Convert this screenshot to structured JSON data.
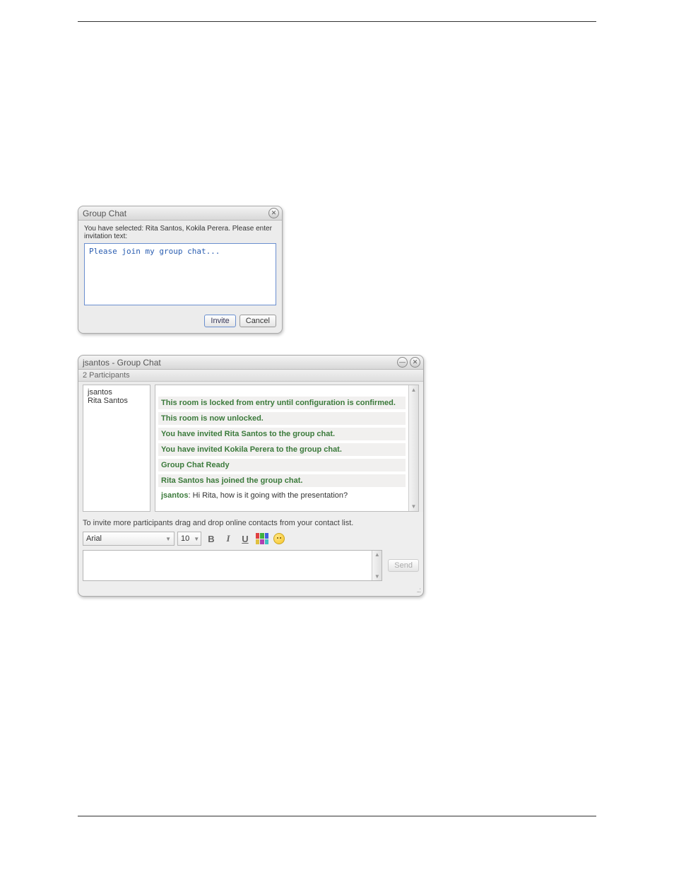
{
  "invite_dialog": {
    "title": "Group Chat",
    "selected_text": "You have selected: Rita Santos, Kokila Perera. Please enter invitation text:",
    "textarea_value": "Please join my group chat...",
    "invite_label": "Invite",
    "cancel_label": "Cancel"
  },
  "chat_window": {
    "title": "jsantos - Group Chat",
    "subhead": "2 Participants",
    "participants": [
      "jsantos",
      "Rita Santos"
    ],
    "transcript": {
      "system_messages": [
        "This room is locked from entry until configuration is confirmed.",
        "This room is now unlocked.",
        "You have invited Rita Santos to the group chat.",
        "You have invited Kokila Perera to the group chat.",
        "Group Chat Ready",
        "Rita Santos has joined the group chat."
      ],
      "chat_message": {
        "sender": "jsantos",
        "text": "Hi Rita, how is it going with the presentation?"
      }
    },
    "invite_hint": "To invite more participants drag and drop online contacts from your contact list.",
    "format": {
      "font": "Arial",
      "size": "10"
    },
    "compose_placeholder": "",
    "send_label": "Send"
  }
}
